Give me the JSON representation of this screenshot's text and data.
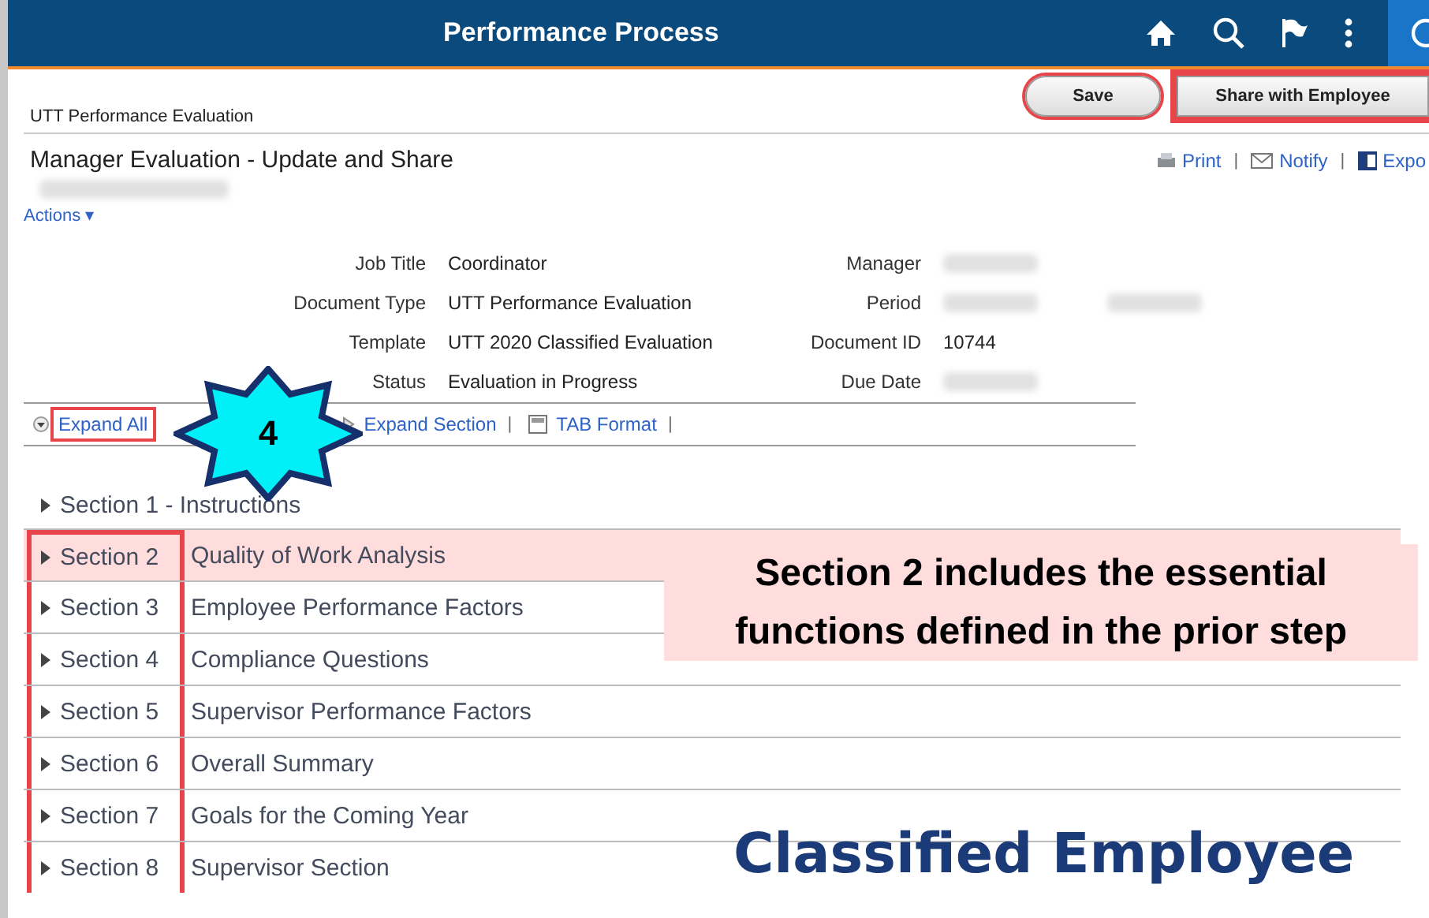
{
  "header": {
    "title": "Performance Process"
  },
  "page": {
    "subtitle": "UTT Performance Evaluation",
    "title": "Manager Evaluation - Update and Share",
    "employee_hidden": true,
    "actions": "Actions",
    "actions_caret": "▾"
  },
  "buttons": [
    {
      "label": "Save",
      "kind": "ellipse"
    },
    {
      "label": "Share with Employee",
      "kind": "rect"
    }
  ],
  "separator": "|",
  "links": [
    {
      "label": "Print",
      "kind": "print"
    },
    {
      "label": "Notify",
      "kind": "notify"
    },
    {
      "label": "Expo",
      "kind": "export"
    }
  ],
  "fields_left": [
    {
      "label": "Job Title",
      "value": "Coordinator"
    },
    {
      "label": "Document Type",
      "value": "UTT Performance Evaluation"
    },
    {
      "label": "Template",
      "value": "UTT 2020 Classified Evaluation"
    },
    {
      "label": "Status",
      "value": "Evaluation in Progress"
    }
  ],
  "fields_right": [
    {
      "label": "Manager",
      "hidden": true,
      "kind": "single"
    },
    {
      "label": "Period",
      "hidden": true,
      "kind": "range"
    },
    {
      "label": "Document ID",
      "hidden": false,
      "value": "10744"
    },
    {
      "label": "Due Date",
      "hidden": true,
      "kind": "single"
    }
  ],
  "toolbar": [
    {
      "label": "Expand All",
      "kind": "expand-all",
      "highlight": true
    },
    {
      "label": "Expand Section",
      "kind": "expand-section",
      "highlight": false
    },
    {
      "label": "TAB Format",
      "kind": "tab-format",
      "highlight": false
    }
  ],
  "sections": [
    {
      "label": "Section 1 - Instructions",
      "highlight": false,
      "framed": false
    },
    {
      "label": "Section 2",
      "title": "Quality of Work Analysis",
      "highlight": true,
      "framed": true
    },
    {
      "label": "Section 3",
      "title": "Employee Performance Factors",
      "highlight": false,
      "framed": true
    },
    {
      "label": "Section 4",
      "title": "Compliance Questions",
      "highlight": false,
      "framed": true
    },
    {
      "label": "Section 5",
      "title": "Supervisor Performance Factors",
      "highlight": false,
      "framed": true
    },
    {
      "label": "Section 6",
      "title": "Overall Summary",
      "highlight": false,
      "framed": true
    },
    {
      "label": "Section 7",
      "title": "Goals for the Coming Year",
      "highlight": false,
      "framed": true
    },
    {
      "label": "Section 8",
      "title": "Supervisor Section",
      "highlight": false,
      "framed": true
    }
  ],
  "annotations": {
    "step_badge": "4",
    "callout": "Section 2 includes the essential functions defined in the prior step",
    "caption": "Classified Employee"
  }
}
